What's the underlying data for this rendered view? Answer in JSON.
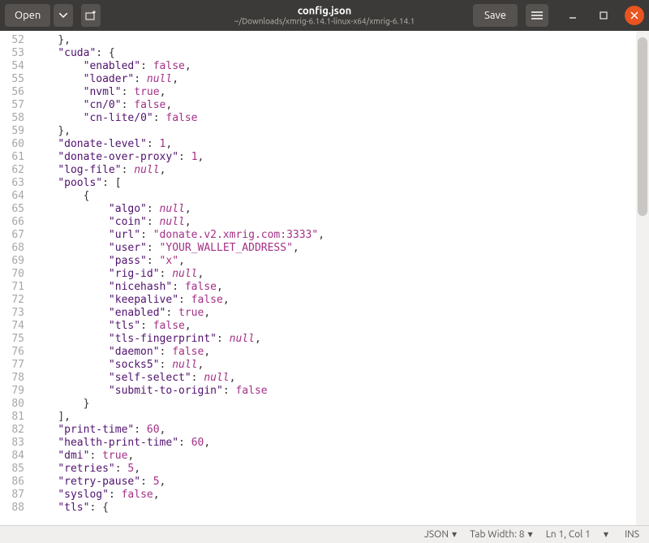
{
  "header": {
    "open_label": "Open",
    "save_label": "Save",
    "title": "config.json",
    "subtitle": "~/Downloads/xmrig-6.14.1-linux-x64/xmrig-6.14.1"
  },
  "statusbar": {
    "filetype": "JSON",
    "tabwidth": "Tab Width: 8",
    "position": "Ln 1, Col 1",
    "insert": "INS"
  },
  "code_lines": [
    {
      "num": "52",
      "indent": 4,
      "tokens": [
        {
          "t": "}",
          "c": "pn"
        },
        {
          "t": ",",
          "c": "pn"
        }
      ]
    },
    {
      "num": "53",
      "indent": 4,
      "tokens": [
        {
          "t": "\"cuda\"",
          "c": "key"
        },
        {
          "t": ": {",
          "c": "pn"
        }
      ]
    },
    {
      "num": "54",
      "indent": 8,
      "tokens": [
        {
          "t": "\"enabled\"",
          "c": "key"
        },
        {
          "t": ": ",
          "c": "pn"
        },
        {
          "t": "false",
          "c": "bool"
        },
        {
          "t": ",",
          "c": "pn"
        }
      ]
    },
    {
      "num": "55",
      "indent": 8,
      "tokens": [
        {
          "t": "\"loader\"",
          "c": "key"
        },
        {
          "t": ": ",
          "c": "pn"
        },
        {
          "t": "null",
          "c": "null"
        },
        {
          "t": ",",
          "c": "pn"
        }
      ]
    },
    {
      "num": "56",
      "indent": 8,
      "tokens": [
        {
          "t": "\"nvml\"",
          "c": "key"
        },
        {
          "t": ": ",
          "c": "pn"
        },
        {
          "t": "true",
          "c": "bool"
        },
        {
          "t": ",",
          "c": "pn"
        }
      ]
    },
    {
      "num": "57",
      "indent": 8,
      "tokens": [
        {
          "t": "\"cn/0\"",
          "c": "key"
        },
        {
          "t": ": ",
          "c": "pn"
        },
        {
          "t": "false",
          "c": "bool"
        },
        {
          "t": ",",
          "c": "pn"
        }
      ]
    },
    {
      "num": "58",
      "indent": 8,
      "tokens": [
        {
          "t": "\"cn-lite/0\"",
          "c": "key"
        },
        {
          "t": ": ",
          "c": "pn"
        },
        {
          "t": "false",
          "c": "bool"
        }
      ]
    },
    {
      "num": "59",
      "indent": 4,
      "tokens": [
        {
          "t": "}",
          "c": "pn"
        },
        {
          "t": ",",
          "c": "pn"
        }
      ]
    },
    {
      "num": "60",
      "indent": 4,
      "tokens": [
        {
          "t": "\"donate-level\"",
          "c": "key"
        },
        {
          "t": ": ",
          "c": "pn"
        },
        {
          "t": "1",
          "c": "num"
        },
        {
          "t": ",",
          "c": "pn"
        }
      ]
    },
    {
      "num": "61",
      "indent": 4,
      "tokens": [
        {
          "t": "\"donate-over-proxy\"",
          "c": "key"
        },
        {
          "t": ": ",
          "c": "pn"
        },
        {
          "t": "1",
          "c": "num"
        },
        {
          "t": ",",
          "c": "pn"
        }
      ]
    },
    {
      "num": "62",
      "indent": 4,
      "tokens": [
        {
          "t": "\"log-file\"",
          "c": "key"
        },
        {
          "t": ": ",
          "c": "pn"
        },
        {
          "t": "null",
          "c": "null"
        },
        {
          "t": ",",
          "c": "pn"
        }
      ]
    },
    {
      "num": "63",
      "indent": 4,
      "tokens": [
        {
          "t": "\"pools\"",
          "c": "key"
        },
        {
          "t": ": [",
          "c": "pn"
        }
      ]
    },
    {
      "num": "64",
      "indent": 8,
      "tokens": [
        {
          "t": "{",
          "c": "pn"
        }
      ]
    },
    {
      "num": "65",
      "indent": 12,
      "tokens": [
        {
          "t": "\"algo\"",
          "c": "key"
        },
        {
          "t": ": ",
          "c": "pn"
        },
        {
          "t": "null",
          "c": "null"
        },
        {
          "t": ",",
          "c": "pn"
        }
      ]
    },
    {
      "num": "66",
      "indent": 12,
      "tokens": [
        {
          "t": "\"coin\"",
          "c": "key"
        },
        {
          "t": ": ",
          "c": "pn"
        },
        {
          "t": "null",
          "c": "null"
        },
        {
          "t": ",",
          "c": "pn"
        }
      ]
    },
    {
      "num": "67",
      "indent": 12,
      "tokens": [
        {
          "t": "\"url\"",
          "c": "key"
        },
        {
          "t": ": ",
          "c": "pn"
        },
        {
          "t": "\"donate.v2.xmrig.com:3333\"",
          "c": "str"
        },
        {
          "t": ",",
          "c": "pn"
        }
      ]
    },
    {
      "num": "68",
      "indent": 12,
      "tokens": [
        {
          "t": "\"user\"",
          "c": "key"
        },
        {
          "t": ": ",
          "c": "pn"
        },
        {
          "t": "\"YOUR_WALLET_ADDRESS\"",
          "c": "str"
        },
        {
          "t": ",",
          "c": "pn"
        }
      ]
    },
    {
      "num": "69",
      "indent": 12,
      "tokens": [
        {
          "t": "\"pass\"",
          "c": "key"
        },
        {
          "t": ": ",
          "c": "pn"
        },
        {
          "t": "\"x\"",
          "c": "str"
        },
        {
          "t": ",",
          "c": "pn"
        }
      ]
    },
    {
      "num": "70",
      "indent": 12,
      "tokens": [
        {
          "t": "\"rig-id\"",
          "c": "key"
        },
        {
          "t": ": ",
          "c": "pn"
        },
        {
          "t": "null",
          "c": "null"
        },
        {
          "t": ",",
          "c": "pn"
        }
      ]
    },
    {
      "num": "71",
      "indent": 12,
      "tokens": [
        {
          "t": "\"nicehash\"",
          "c": "key"
        },
        {
          "t": ": ",
          "c": "pn"
        },
        {
          "t": "false",
          "c": "bool"
        },
        {
          "t": ",",
          "c": "pn"
        }
      ]
    },
    {
      "num": "72",
      "indent": 12,
      "tokens": [
        {
          "t": "\"keepalive\"",
          "c": "key"
        },
        {
          "t": ": ",
          "c": "pn"
        },
        {
          "t": "false",
          "c": "bool"
        },
        {
          "t": ",",
          "c": "pn"
        }
      ]
    },
    {
      "num": "73",
      "indent": 12,
      "tokens": [
        {
          "t": "\"enabled\"",
          "c": "key"
        },
        {
          "t": ": ",
          "c": "pn"
        },
        {
          "t": "true",
          "c": "bool"
        },
        {
          "t": ",",
          "c": "pn"
        }
      ]
    },
    {
      "num": "74",
      "indent": 12,
      "tokens": [
        {
          "t": "\"tls\"",
          "c": "key"
        },
        {
          "t": ": ",
          "c": "pn"
        },
        {
          "t": "false",
          "c": "bool"
        },
        {
          "t": ",",
          "c": "pn"
        }
      ]
    },
    {
      "num": "75",
      "indent": 12,
      "tokens": [
        {
          "t": "\"tls-fingerprint\"",
          "c": "key"
        },
        {
          "t": ": ",
          "c": "pn"
        },
        {
          "t": "null",
          "c": "null"
        },
        {
          "t": ",",
          "c": "pn"
        }
      ]
    },
    {
      "num": "76",
      "indent": 12,
      "tokens": [
        {
          "t": "\"daemon\"",
          "c": "key"
        },
        {
          "t": ": ",
          "c": "pn"
        },
        {
          "t": "false",
          "c": "bool"
        },
        {
          "t": ",",
          "c": "pn"
        }
      ]
    },
    {
      "num": "77",
      "indent": 12,
      "tokens": [
        {
          "t": "\"socks5\"",
          "c": "key"
        },
        {
          "t": ": ",
          "c": "pn"
        },
        {
          "t": "null",
          "c": "null"
        },
        {
          "t": ",",
          "c": "pn"
        }
      ]
    },
    {
      "num": "78",
      "indent": 12,
      "tokens": [
        {
          "t": "\"self-select\"",
          "c": "key"
        },
        {
          "t": ": ",
          "c": "pn"
        },
        {
          "t": "null",
          "c": "null"
        },
        {
          "t": ",",
          "c": "pn"
        }
      ]
    },
    {
      "num": "79",
      "indent": 12,
      "tokens": [
        {
          "t": "\"submit-to-origin\"",
          "c": "key"
        },
        {
          "t": ": ",
          "c": "pn"
        },
        {
          "t": "false",
          "c": "bool"
        }
      ]
    },
    {
      "num": "80",
      "indent": 8,
      "tokens": [
        {
          "t": "}",
          "c": "pn"
        }
      ]
    },
    {
      "num": "81",
      "indent": 4,
      "tokens": [
        {
          "t": "]",
          "c": "pn"
        },
        {
          "t": ",",
          "c": "pn"
        }
      ]
    },
    {
      "num": "82",
      "indent": 4,
      "tokens": [
        {
          "t": "\"print-time\"",
          "c": "key"
        },
        {
          "t": ": ",
          "c": "pn"
        },
        {
          "t": "60",
          "c": "num"
        },
        {
          "t": ",",
          "c": "pn"
        }
      ]
    },
    {
      "num": "83",
      "indent": 4,
      "tokens": [
        {
          "t": "\"health-print-time\"",
          "c": "key"
        },
        {
          "t": ": ",
          "c": "pn"
        },
        {
          "t": "60",
          "c": "num"
        },
        {
          "t": ",",
          "c": "pn"
        }
      ]
    },
    {
      "num": "84",
      "indent": 4,
      "tokens": [
        {
          "t": "\"dmi\"",
          "c": "key"
        },
        {
          "t": ": ",
          "c": "pn"
        },
        {
          "t": "true",
          "c": "bool"
        },
        {
          "t": ",",
          "c": "pn"
        }
      ]
    },
    {
      "num": "85",
      "indent": 4,
      "tokens": [
        {
          "t": "\"retries\"",
          "c": "key"
        },
        {
          "t": ": ",
          "c": "pn"
        },
        {
          "t": "5",
          "c": "num"
        },
        {
          "t": ",",
          "c": "pn"
        }
      ]
    },
    {
      "num": "86",
      "indent": 4,
      "tokens": [
        {
          "t": "\"retry-pause\"",
          "c": "key"
        },
        {
          "t": ": ",
          "c": "pn"
        },
        {
          "t": "5",
          "c": "num"
        },
        {
          "t": ",",
          "c": "pn"
        }
      ]
    },
    {
      "num": "87",
      "indent": 4,
      "tokens": [
        {
          "t": "\"syslog\"",
          "c": "key"
        },
        {
          "t": ": ",
          "c": "pn"
        },
        {
          "t": "false",
          "c": "bool"
        },
        {
          "t": ",",
          "c": "pn"
        }
      ]
    },
    {
      "num": "88",
      "indent": 4,
      "tokens": [
        {
          "t": "\"tls\"",
          "c": "key"
        },
        {
          "t": ": {",
          "c": "pn"
        }
      ]
    }
  ]
}
